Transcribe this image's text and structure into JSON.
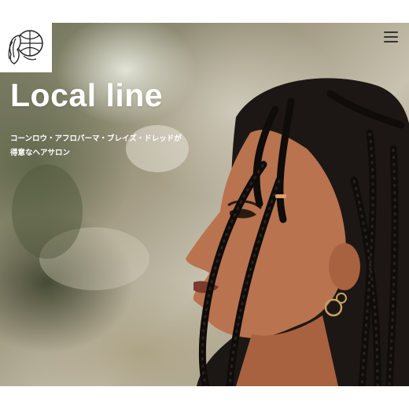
{
  "header": {
    "logo_icon": "lion-globe-logo-icon",
    "menu_icon": "hamburger-menu-icon"
  },
  "hero": {
    "title": "Local line",
    "tagline_line1": "コーンロウ・アフロパーマ・ブレイズ・ドレッドが",
    "tagline_line2": "得意なヘアサロン",
    "image": "woman-with-braids-profile-photo"
  },
  "colors": {
    "title_text": "#ffffff",
    "menu_icon": "#333333",
    "page_background": "#ffffff"
  }
}
